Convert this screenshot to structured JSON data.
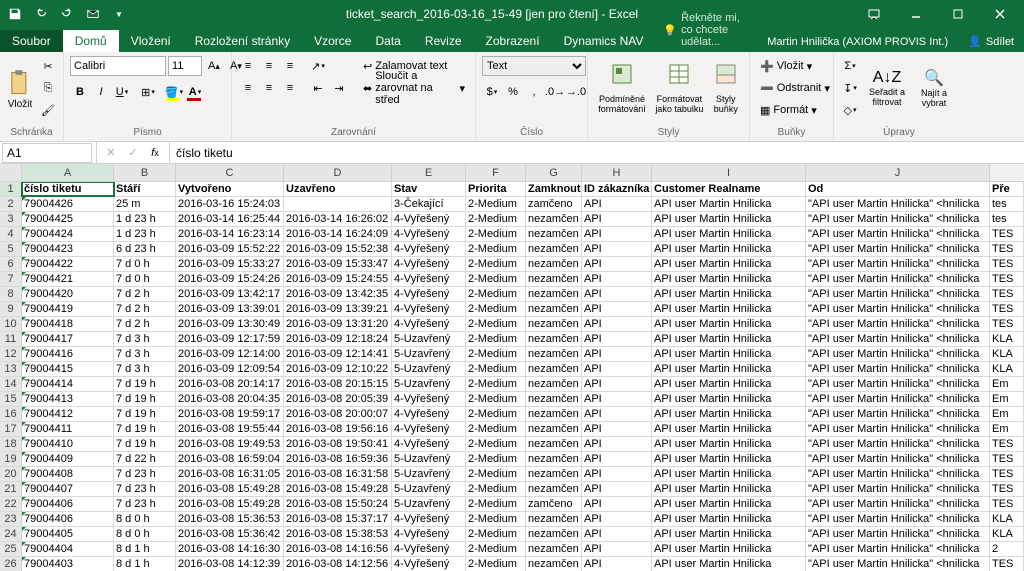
{
  "title": "ticket_search_2016-03-16_15-49  [jen pro čtení] - Excel",
  "tabs": {
    "file": "Soubor",
    "home": "Domů",
    "insert": "Vložení",
    "layout": "Rozložení stránky",
    "formulas": "Vzorce",
    "data": "Data",
    "review": "Revize",
    "view": "Zobrazení",
    "nav": "Dynamics NAV"
  },
  "tellme": "Řekněte mi, co chcete udělat...",
  "account": "Martin Hnilička (AXIOM PROVIS Int.)",
  "share": "Sdílet",
  "ribbon": {
    "clipboard": {
      "label": "Schránka",
      "paste": "Vložit"
    },
    "font": {
      "label": "Písmo",
      "name": "Calibri",
      "size": "11"
    },
    "alignment": {
      "label": "Zarovnání",
      "wrap": "Zalamovat text",
      "merge": "Sloučit a zarovnat na střed"
    },
    "number": {
      "label": "Číslo",
      "format": "Text"
    },
    "styles": {
      "label": "Styly",
      "cond": "Podmíněné formátování",
      "table": "Formátovat jako tabulku",
      "cell": "Styly buňky"
    },
    "cells": {
      "label": "Buňky",
      "insert": "Vložit",
      "delete": "Odstranit",
      "format": "Formát"
    },
    "editing": {
      "label": "Úpravy",
      "sort": "Seřadit a filtrovat",
      "find": "Najít a vybrat"
    }
  },
  "namebox": "A1",
  "formula": "číslo tiketu",
  "cols": [
    "A",
    "B",
    "C",
    "D",
    "E",
    "F",
    "G",
    "H",
    "I",
    "J"
  ],
  "headers": [
    "číslo tiketu",
    "Stáří",
    "Vytvořeno",
    "Uzavřeno",
    "Stav",
    "Priorita",
    "Zamknout",
    "ID zákazníka",
    "Customer Realname",
    "Od",
    "Pře"
  ],
  "rows": [
    [
      "79004426",
      "25 m",
      "2016-03-16 15:24:03",
      "",
      "3-Čekající",
      "2-Medium",
      "zamčeno",
      "API",
      "API user Martin Hnilicka",
      "\"API user Martin Hnilicka\" <hnilicka",
      "tes"
    ],
    [
      "79004425",
      "1 d 23 h",
      "2016-03-14 16:25:44",
      "2016-03-14 16:26:02",
      "4-Vyřešený",
      "2-Medium",
      "nezamčen",
      "API",
      "API user Martin Hnilicka",
      "\"API user Martin Hnilicka\" <hnilicka",
      "tes"
    ],
    [
      "79004424",
      "1 d 23 h",
      "2016-03-14 16:23:14",
      "2016-03-14 16:24:09",
      "4-Vyřešený",
      "2-Medium",
      "nezamčen",
      "API",
      "API user Martin Hnilicka",
      "\"API user Martin Hnilicka\" <hnilicka",
      "TES"
    ],
    [
      "79004423",
      "6 d 23 h",
      "2016-03-09 15:52:22",
      "2016-03-09 15:52:38",
      "4-Vyřešený",
      "2-Medium",
      "nezamčen",
      "API",
      "API user Martin Hnilicka",
      "\"API user Martin Hnilicka\" <hnilicka",
      "TES"
    ],
    [
      "79004422",
      "7 d 0 h",
      "2016-03-09 15:33:27",
      "2016-03-09 15:33:47",
      "4-Vyřešený",
      "2-Medium",
      "nezamčen",
      "API",
      "API user Martin Hnilicka",
      "\"API user Martin Hnilicka\" <hnilicka",
      "TES"
    ],
    [
      "79004421",
      "7 d 0 h",
      "2016-03-09 15:24:26",
      "2016-03-09 15:24:55",
      "4-Vyřešený",
      "2-Medium",
      "nezamčen",
      "API",
      "API user Martin Hnilicka",
      "\"API user Martin Hnilicka\" <hnilicka",
      "TES"
    ],
    [
      "79004420",
      "7 d 2 h",
      "2016-03-09 13:42:17",
      "2016-03-09 13:42:35",
      "4-Vyřešený",
      "2-Medium",
      "nezamčen",
      "API",
      "API user Martin Hnilicka",
      "\"API user Martin Hnilicka\" <hnilicka",
      "TES"
    ],
    [
      "79004419",
      "7 d 2 h",
      "2016-03-09 13:39:01",
      "2016-03-09 13:39:21",
      "4-Vyřešený",
      "2-Medium",
      "nezamčen",
      "API",
      "API user Martin Hnilicka",
      "\"API user Martin Hnilicka\" <hnilicka",
      "TES"
    ],
    [
      "79004418",
      "7 d 2 h",
      "2016-03-09 13:30:49",
      "2016-03-09 13:31:20",
      "4-Vyřešený",
      "2-Medium",
      "nezamčen",
      "API",
      "API user Martin Hnilicka",
      "\"API user Martin Hnilicka\" <hnilicka",
      "TES"
    ],
    [
      "79004417",
      "7 d 3 h",
      "2016-03-09 12:17:59",
      "2016-03-09 12:18:24",
      "5-Uzavřený",
      "2-Medium",
      "nezamčen",
      "API",
      "API user Martin Hnilicka",
      "\"API user Martin Hnilicka\" <hnilicka",
      "KLA"
    ],
    [
      "79004416",
      "7 d 3 h",
      "2016-03-09 12:14:00",
      "2016-03-09 12:14:41",
      "5-Uzavřený",
      "2-Medium",
      "nezamčen",
      "API",
      "API user Martin Hnilicka",
      "\"API user Martin Hnilicka\" <hnilicka",
      "KLA"
    ],
    [
      "79004415",
      "7 d 3 h",
      "2016-03-09 12:09:54",
      "2016-03-09 12:10:22",
      "5-Uzavřený",
      "2-Medium",
      "nezamčen",
      "API",
      "API user Martin Hnilicka",
      "\"API user Martin Hnilicka\" <hnilicka",
      "KLA"
    ],
    [
      "79004414",
      "7 d 19 h",
      "2016-03-08 20:14:17",
      "2016-03-08 20:15:15",
      "5-Uzavřený",
      "2-Medium",
      "nezamčen",
      "API",
      "API user Martin Hnilicka",
      "\"API user Martin Hnilicka\" <hnilicka",
      "Em"
    ],
    [
      "79004413",
      "7 d 19 h",
      "2016-03-08 20:04:35",
      "2016-03-08 20:05:39",
      "4-Vyřešený",
      "2-Medium",
      "nezamčen",
      "API",
      "API user Martin Hnilicka",
      "\"API user Martin Hnilicka\" <hnilicka",
      "Em"
    ],
    [
      "79004412",
      "7 d 19 h",
      "2016-03-08 19:59:17",
      "2016-03-08 20:00:07",
      "4-Vyřešený",
      "2-Medium",
      "nezamčen",
      "API",
      "API user Martin Hnilicka",
      "\"API user Martin Hnilicka\" <hnilicka",
      "Em"
    ],
    [
      "79004411",
      "7 d 19 h",
      "2016-03-08 19:55:44",
      "2016-03-08 19:56:16",
      "4-Vyřešený",
      "2-Medium",
      "nezamčen",
      "API",
      "API user Martin Hnilicka",
      "\"API user Martin Hnilicka\" <hnilicka",
      "Em"
    ],
    [
      "79004410",
      "7 d 19 h",
      "2016-03-08 19:49:53",
      "2016-03-08 19:50:41",
      "4-Vyřešený",
      "2-Medium",
      "nezamčen",
      "API",
      "API user Martin Hnilicka",
      "\"API user Martin Hnilicka\" <hnilicka",
      "TES"
    ],
    [
      "79004409",
      "7 d 22 h",
      "2016-03-08 16:59:04",
      "2016-03-08 16:59:36",
      "5-Uzavřený",
      "2-Medium",
      "nezamčen",
      "API",
      "API user Martin Hnilicka",
      "\"API user Martin Hnilicka\" <hnilicka",
      "TES"
    ],
    [
      "79004408",
      "7 d 23 h",
      "2016-03-08 16:31:05",
      "2016-03-08 16:31:58",
      "5-Uzavřený",
      "2-Medium",
      "nezamčen",
      "API",
      "API user Martin Hnilicka",
      "\"API user Martin Hnilicka\" <hnilicka",
      "TES"
    ],
    [
      "79004407",
      "7 d 23 h",
      "2016-03-08 15:49:28",
      "2016-03-08 15:49:28",
      "5-Uzavřený",
      "2-Medium",
      "nezamčen",
      "API",
      "API user Martin Hnilicka",
      "\"API user Martin Hnilicka\" <hnilicka",
      "TES"
    ],
    [
      "79004406",
      "7 d 23 h",
      "2016-03-08 15:49:28",
      "2016-03-08 15:50:24",
      "5-Uzavřený",
      "2-Medium",
      "zamčeno",
      "API",
      "API user Martin Hnilicka",
      "\"API user Martin Hnilicka\" <hnilicka",
      "TES"
    ],
    [
      "79004406",
      "8 d 0 h",
      "2016-03-08 15:36:53",
      "2016-03-08 15:37:17",
      "4-Vyřešený",
      "2-Medium",
      "nezamčen",
      "API",
      "API user Martin Hnilicka",
      "\"API user Martin Hnilicka\" <hnilicka",
      "KLA"
    ],
    [
      "79004405",
      "8 d 0 h",
      "2016-03-08 15:36:42",
      "2016-03-08 15:38:53",
      "4-Vyřešený",
      "2-Medium",
      "nezamčen",
      "API",
      "API user Martin Hnilicka",
      "\"API user Martin Hnilicka\" <hnilicka",
      "KLA"
    ],
    [
      "79004404",
      "8 d 1 h",
      "2016-03-08 14:16:30",
      "2016-03-08 14:16:56",
      "4-Vyřešený",
      "2-Medium",
      "nezamčen",
      "API",
      "API user Martin Hnilicka",
      "\"API user Martin Hnilicka\" <hnilicka",
      "2"
    ],
    [
      "79004403",
      "8 d 1 h",
      "2016-03-08 14:12:39",
      "2016-03-08 14:12:56",
      "4-Vyřešený",
      "2-Medium",
      "nezamčen",
      "API",
      "API user Martin Hnilicka",
      "\"API user Martin Hnilicka\" <hnilicka",
      "TES"
    ]
  ]
}
